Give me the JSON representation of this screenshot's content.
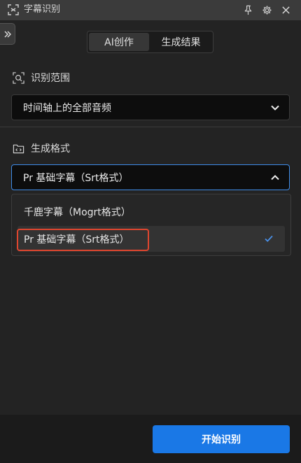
{
  "window": {
    "title": "字幕识别",
    "icons": {
      "app": "subtitle-recognition-icon",
      "pin": "pin-icon",
      "settings": "gear-icon",
      "close": "close-icon"
    }
  },
  "sidebar_toggle": {
    "icon": "double-chevron-right-icon"
  },
  "tabs": [
    {
      "label": "AI创作",
      "active": true
    },
    {
      "label": "生成结果",
      "active": false
    }
  ],
  "recognition_range": {
    "label": "识别范围",
    "icon": "search-frame-icon",
    "value": "时间轴上的全部音频"
  },
  "output_format": {
    "label": "生成格式",
    "icon": "code-folder-icon",
    "value": "Pr 基础字幕（Srt格式）",
    "options": [
      {
        "label": "千鹿字幕（Mogrt格式）",
        "selected": false
      },
      {
        "label": "Pr 基础字幕（Srt格式）",
        "selected": true
      }
    ]
  },
  "start_button": {
    "label": "开始识别"
  },
  "colors": {
    "accent": "#1a78e6",
    "highlight": "#e0462f",
    "background": "#232323",
    "titlebar": "#3b3b3b"
  }
}
